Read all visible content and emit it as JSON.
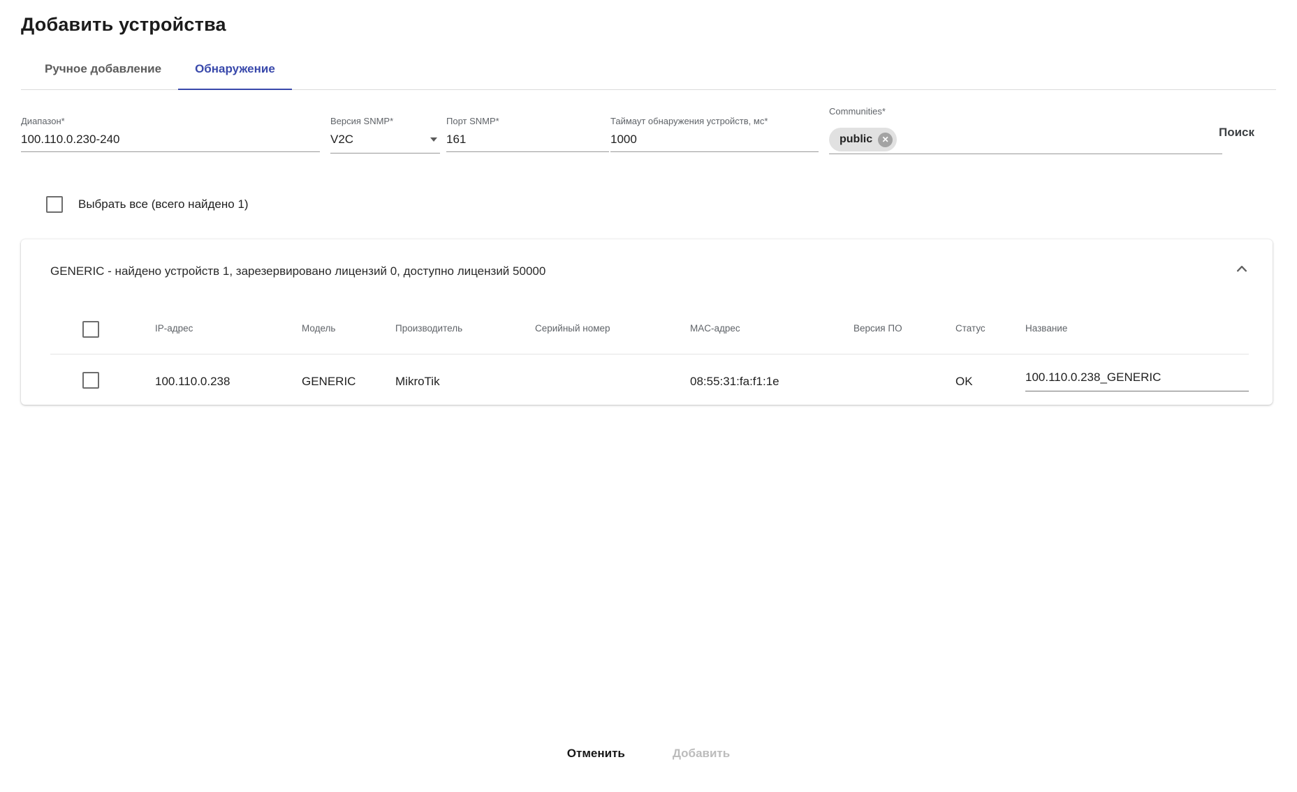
{
  "page": {
    "title": "Добавить устройства"
  },
  "tabs": [
    {
      "label": "Ручное добавление",
      "active": false
    },
    {
      "label": "Обнаружение",
      "active": true
    }
  ],
  "form": {
    "fields": [
      {
        "label": "Диапазон*",
        "value": "100.110.0.230-240",
        "type": "text"
      },
      {
        "label": "Версия SNMP*",
        "value": "V2C",
        "type": "select"
      },
      {
        "label": "Порт SNMP*",
        "value": "161",
        "type": "text"
      },
      {
        "label": "Таймаут обнаружения устройств, мс*",
        "value": "1000",
        "type": "text"
      },
      {
        "label": "Communities*",
        "chip": "public",
        "type": "chips"
      }
    ],
    "search_label": "Поиск"
  },
  "select_all": {
    "label": "Выбрать все (всего найдено 1)",
    "checked": false
  },
  "group": {
    "summary": "GENERIC - найдено устройств 1, зарезервировано лицензий 0, доступно лицензий 50000",
    "collapsed": false,
    "columns": [
      "IP-адрес",
      "Модель",
      "Производитель",
      "Серийный номер",
      "MAC-адрес",
      "Версия ПО",
      "Статус",
      "Название"
    ],
    "rows": [
      {
        "checked": false,
        "ip": "100.110.0.238",
        "model": "GENERIC",
        "vendor": "MikroTik",
        "serial": "",
        "mac": "08:55:31:fa:f1:1e",
        "firmware": "",
        "status": "OK",
        "name": "100.110.0.238_GENERIC"
      }
    ]
  },
  "footer": {
    "cancel_label": "Отменить",
    "add_label": "Добавить",
    "add_disabled": true
  },
  "icons": {
    "chip_remove_glyph": "✕",
    "select_arrow": "chevron-down-icon",
    "group_collapse": "chevron-up-icon"
  },
  "colors": {
    "accent": "#3949ab",
    "disabled_text": "#bcbcbc",
    "chip_bg": "#e1e1e1"
  }
}
